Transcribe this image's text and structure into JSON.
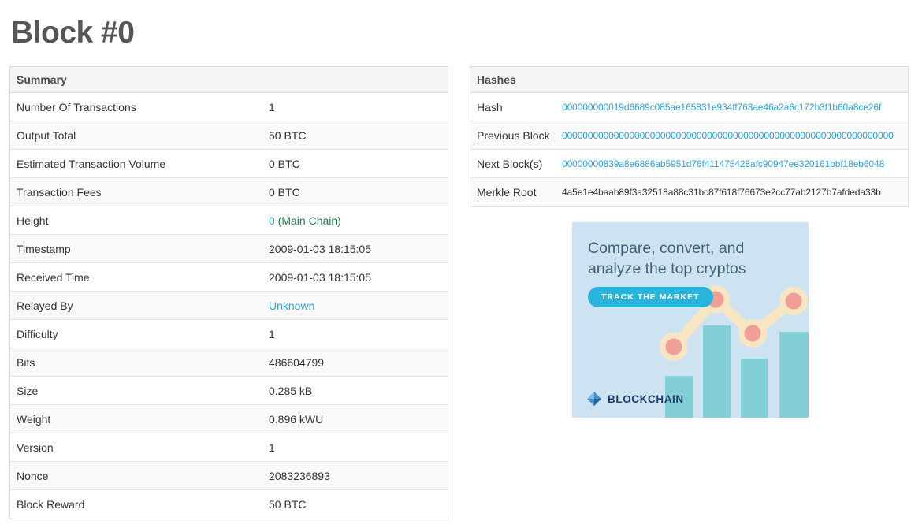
{
  "page": {
    "title": "Block #0"
  },
  "summary": {
    "header": "Summary",
    "rows": [
      {
        "label": "Number Of Transactions",
        "parts": [
          {
            "text": "1",
            "style": "plain"
          }
        ]
      },
      {
        "label": "Output Total",
        "parts": [
          {
            "text": "50 BTC",
            "style": "plain"
          }
        ]
      },
      {
        "label": "Estimated Transaction Volume",
        "parts": [
          {
            "text": "0 BTC",
            "style": "plain"
          }
        ]
      },
      {
        "label": "Transaction Fees",
        "parts": [
          {
            "text": "0 BTC",
            "style": "plain"
          }
        ]
      },
      {
        "label": "Height",
        "parts": [
          {
            "text": "0",
            "style": "link"
          },
          {
            "text": " (Main Chain)",
            "style": "green"
          }
        ]
      },
      {
        "label": "Timestamp",
        "parts": [
          {
            "text": "2009-01-03 18:15:05",
            "style": "plain"
          }
        ]
      },
      {
        "label": "Received Time",
        "parts": [
          {
            "text": "2009-01-03 18:15:05",
            "style": "plain"
          }
        ]
      },
      {
        "label": "Relayed By",
        "parts": [
          {
            "text": "Unknown",
            "style": "link"
          }
        ]
      },
      {
        "label": "Difficulty",
        "parts": [
          {
            "text": "1",
            "style": "plain"
          }
        ]
      },
      {
        "label": "Bits",
        "parts": [
          {
            "text": "486604799",
            "style": "plain"
          }
        ]
      },
      {
        "label": "Size",
        "parts": [
          {
            "text": "0.285 kB",
            "style": "plain"
          }
        ]
      },
      {
        "label": "Weight",
        "parts": [
          {
            "text": "0.896 kWU",
            "style": "plain"
          }
        ]
      },
      {
        "label": "Version",
        "parts": [
          {
            "text": "1",
            "style": "plain"
          }
        ]
      },
      {
        "label": "Nonce",
        "parts": [
          {
            "text": "2083236893",
            "style": "plain"
          }
        ]
      },
      {
        "label": "Block Reward",
        "parts": [
          {
            "text": "50 BTC",
            "style": "plain"
          }
        ]
      }
    ]
  },
  "hashes": {
    "header": "Hashes",
    "rows": [
      {
        "label": "Hash",
        "parts": [
          {
            "text": "000000000019d6689c085ae165831e934ff763ae46a2a6c172b3f1b60a8ce26f",
            "style": "link"
          }
        ]
      },
      {
        "label": "Previous Block",
        "parts": [
          {
            "text": "0000000000000000000000000000000000000000000000000000000000000000",
            "style": "link"
          }
        ]
      },
      {
        "label": "Next Block(s)",
        "parts": [
          {
            "text": "00000000839a8e6886ab5951d76f411475428afc90947ee320161bbf18eb6048",
            "style": "link"
          }
        ]
      },
      {
        "label": "Merkle Root",
        "parts": [
          {
            "text": "4a5e1e4baab89f3a32518a88c31bc87f618f76673e2cc77ab2127b7afdeda33b",
            "style": "plain"
          }
        ]
      }
    ]
  },
  "ad": {
    "headline_line1": "Compare, convert, and",
    "headline_line2": "analyze the top cryptos",
    "cta_label": "TRACK THE MARKET",
    "brand": "BLOCKCHAIN"
  },
  "colors": {
    "link_blue": "#2f9fd4",
    "main_chain_green": "#1e7e45",
    "title_gray": "#565656",
    "table_header_bg": "#f5f5f5",
    "row_stripe_bg": "#f9f9f9",
    "border": "#dddddd",
    "ad_background": "#cde3f1",
    "ad_headline": "#44617a",
    "ad_button": "#29b4dc",
    "ad_bar_teal": "#82d0d6",
    "ad_line_cream": "#f8e6c2",
    "ad_dot_salmon": "#ef9f98",
    "ad_brand_navy": "#1d3d6e"
  }
}
